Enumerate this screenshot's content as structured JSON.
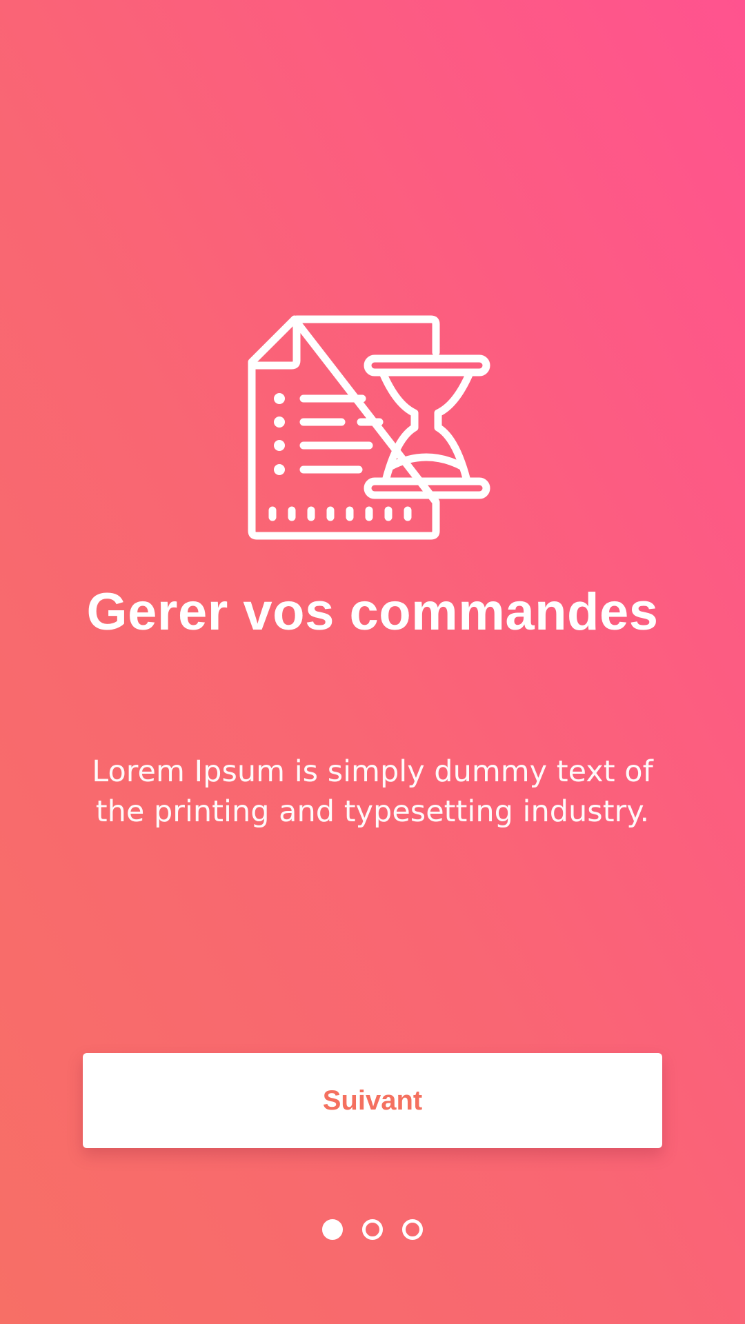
{
  "onboarding": {
    "illustration_icon": "document-hourglass-icon",
    "title": "Gerer vos commandes",
    "description": "Lorem Ipsum is simply dummy text of the printing and typesetting industry.",
    "next_label": "Suivant",
    "pagination": {
      "total_pages": 3,
      "current_page": 1
    }
  },
  "colors": {
    "gradient_top": "#ff538f",
    "gradient_bottom": "#f76f66",
    "button_text": "#f4705f",
    "foreground": "#ffffff"
  }
}
